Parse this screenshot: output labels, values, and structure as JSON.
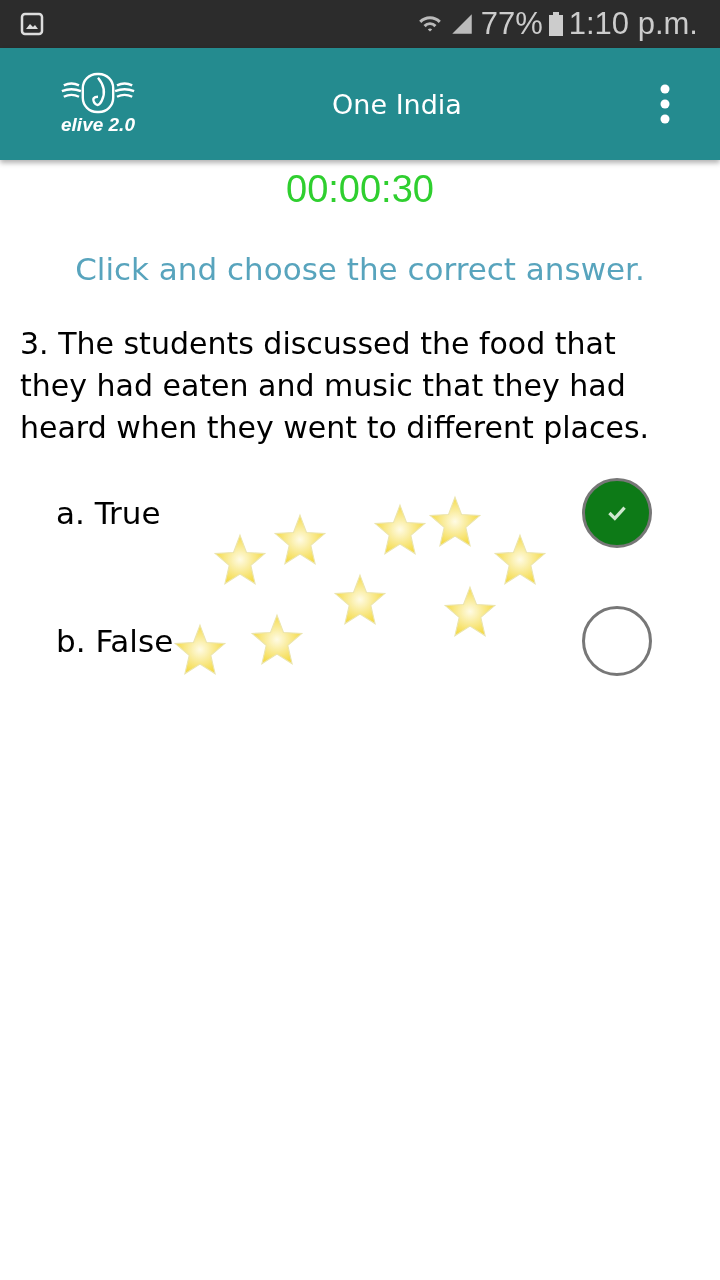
{
  "status_bar": {
    "battery": "77%",
    "time": "1:10 p.m."
  },
  "app_bar": {
    "logo_text": "elive 2.0",
    "title": "One India"
  },
  "timer": "00:00:30",
  "instruction": "Click and choose the correct answer.",
  "question": "3. The students discussed the food that they had eaten and music that they had heard when they went to different places.",
  "options": [
    {
      "label": "a. True",
      "selected": true
    },
    {
      "label": "b. False",
      "selected": false
    }
  ]
}
